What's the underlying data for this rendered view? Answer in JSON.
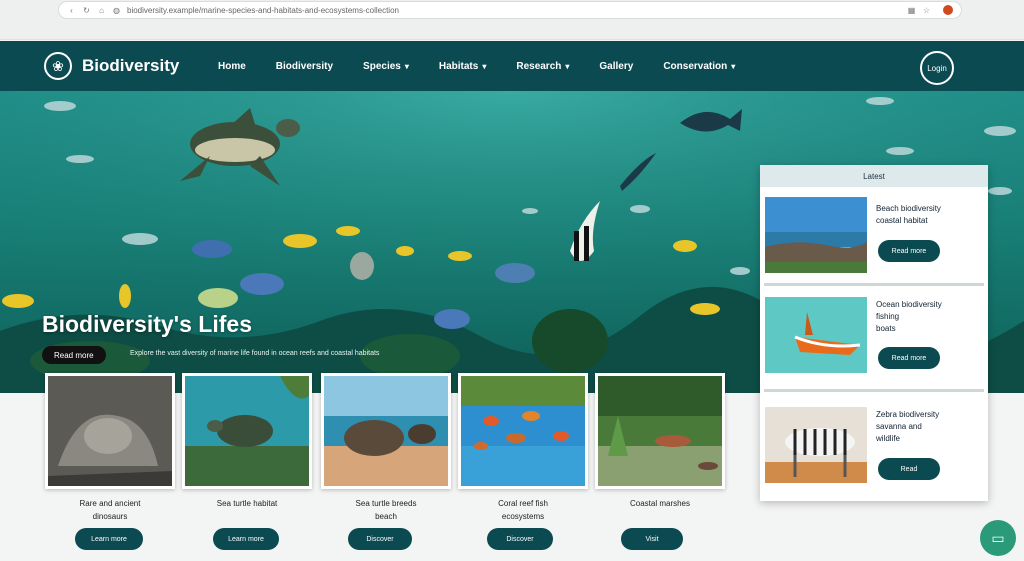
{
  "browser": {
    "url": "biodiversity.example/marine-species-and-habitats-and-ecosystems-collection",
    "icons": [
      "back-icon",
      "refresh-icon",
      "home-icon",
      "shield-icon"
    ]
  },
  "header": {
    "logo_text": "Biodiversity",
    "nav": [
      {
        "label": "Home",
        "dropdown": false
      },
      {
        "label": "Biodiversity",
        "dropdown": false
      },
      {
        "label": "Species",
        "dropdown": true
      },
      {
        "label": "Habitats",
        "dropdown": true
      },
      {
        "label": "Research",
        "dropdown": true
      },
      {
        "label": "Gallery",
        "dropdown": false
      },
      {
        "label": "Conservation",
        "dropdown": true
      }
    ],
    "round_button": "Login"
  },
  "hero": {
    "title": "Biodiversity's Lifes",
    "pill": "Read more",
    "subtitle": "Explore the vast diversity of marine life found in ocean reefs and coastal habitats"
  },
  "cards": [
    {
      "title": "Rare and ancient",
      "title2": "dinosaurs",
      "button": "Learn more"
    },
    {
      "title": "Sea turtle habitat",
      "title2": "",
      "button": "Learn more"
    },
    {
      "title": "Sea turtle breeds",
      "title2": "beach",
      "button": "Discover"
    },
    {
      "title": "Coral reef fish",
      "title2": "ecosystems",
      "button": "Discover"
    },
    {
      "title": "Coastal marshes",
      "title2": "",
      "button": "Visit"
    }
  ],
  "sidebar": {
    "header": "Latest",
    "items": [
      {
        "line1": "Beach biodiversity",
        "line2": "coastal habitat",
        "line3": "",
        "button": "Read more"
      },
      {
        "line1": "Ocean biodiversity",
        "line2": "fishing",
        "line3": "boats",
        "button": "Read more"
      },
      {
        "line1": "Zebra biodiversity",
        "line2": "savanna and",
        "line3": "wildlife",
        "button": "Read"
      }
    ]
  },
  "colors": {
    "primary": "#0c4a52",
    "hero": "#178077",
    "accent_chat": "#2a9a78"
  }
}
